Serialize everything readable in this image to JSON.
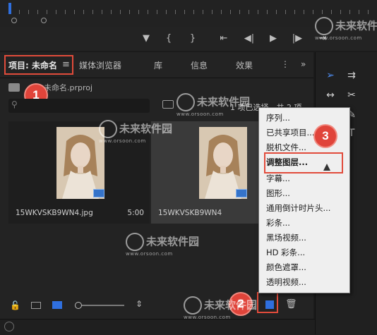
{
  "panel": {
    "tabs": [
      {
        "label": "项目: 未命名"
      },
      {
        "label": "媒体浏览器"
      },
      {
        "label": "库"
      },
      {
        "label": "信息"
      },
      {
        "label": "效果"
      }
    ],
    "menu_icon": "hamburger-icon",
    "more_icon": "double-chevron-right-icon",
    "project_file": "未命名.prproj",
    "selection_status": "1 项已选择，共 2 项",
    "items": [
      {
        "filename": "15WKVSKB9WN4.jpg",
        "duration": "5:00",
        "selected": false
      },
      {
        "filename": "15WKVSKB9WN4",
        "duration": "",
        "selected": true
      }
    ]
  },
  "context_menu": {
    "items": [
      {
        "label": "序列..."
      },
      {
        "label": "已共享项目..."
      },
      {
        "label": "脱机文件..."
      },
      {
        "label": "调整图层..."
      },
      {
        "label": "字幕..."
      },
      {
        "label": "图形..."
      },
      {
        "label": "通用倒计时片头..."
      },
      {
        "label": "彩条..."
      },
      {
        "label": "黑场视频..."
      },
      {
        "label": "HD 彩条..."
      },
      {
        "label": "颜色遮罩..."
      },
      {
        "label": "透明视频..."
      }
    ],
    "highlighted": "调整图层..."
  },
  "annotations": {
    "badge_1": "1",
    "badge_2": "2",
    "badge_3": "3"
  },
  "watermark": {
    "text": "未来软件园",
    "url": "www.orsoon.com"
  },
  "colors": {
    "accent_blue": "#2f6fde",
    "annotation_red": "#e14b3b",
    "panel_bg": "#232323",
    "menu_bg": "#efefef"
  }
}
